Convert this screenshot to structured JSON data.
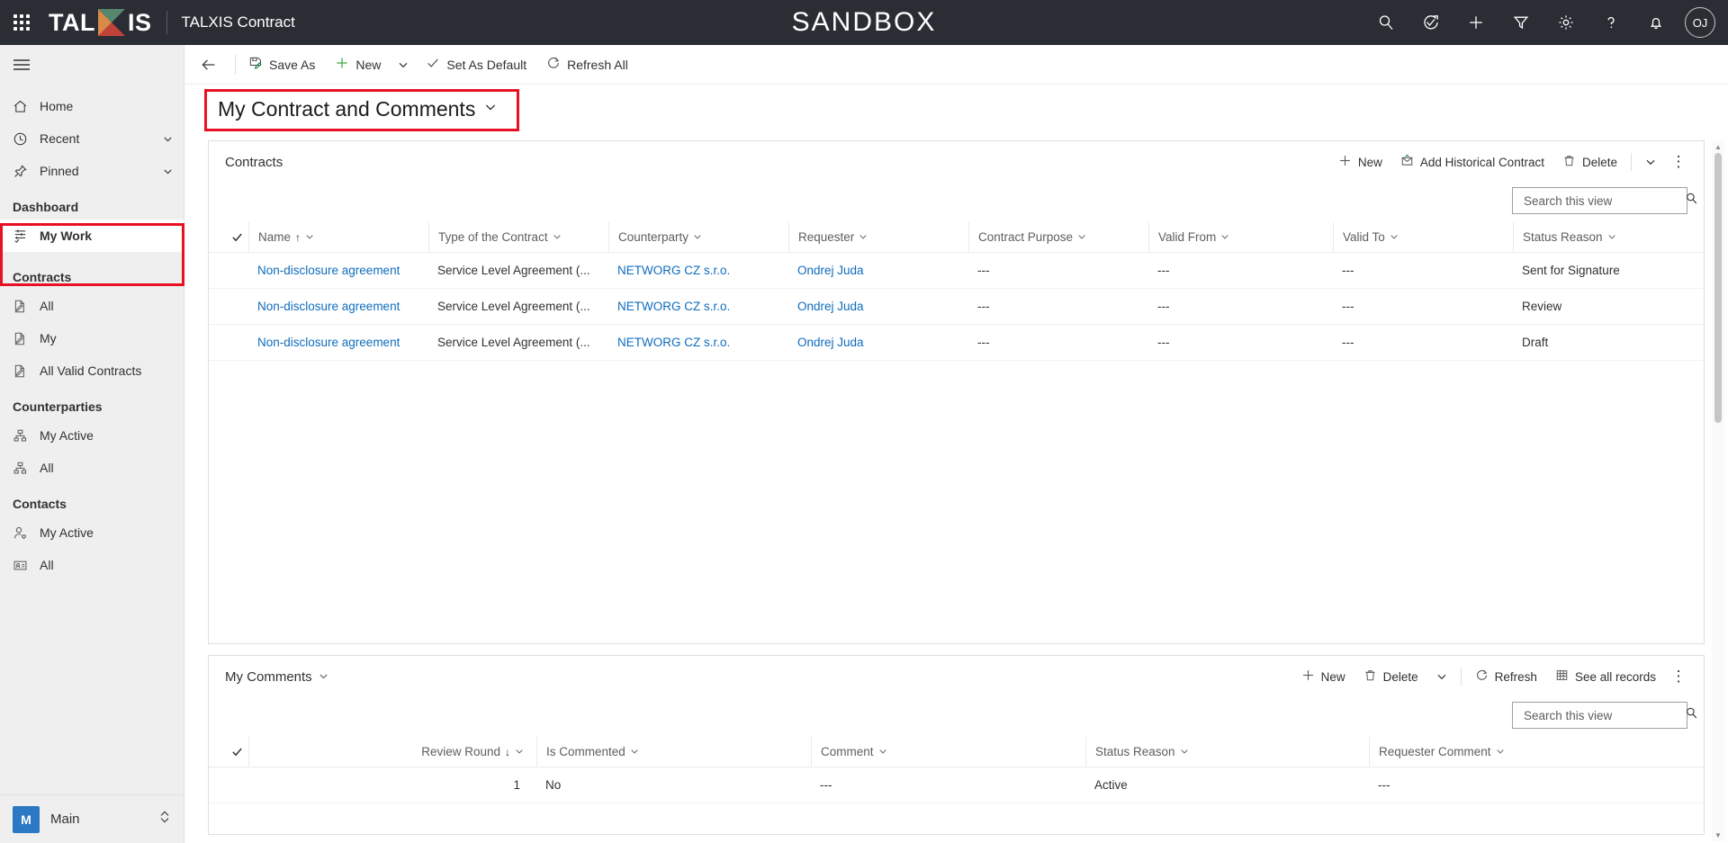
{
  "topbar": {
    "waffle_label": "app-launcher",
    "brand_pre": "TAL",
    "brand_post": "IS",
    "app_name": "TALXIS Contract",
    "environment": "SANDBOX",
    "actions": [
      {
        "name": "search-icon",
        "label": "Search"
      },
      {
        "name": "diagnostics-icon",
        "label": "Diagnostics"
      },
      {
        "name": "quick-create-icon",
        "label": "New"
      },
      {
        "name": "filter-icon",
        "label": "Filter"
      },
      {
        "name": "settings-gear-icon",
        "label": "Settings"
      },
      {
        "name": "help-icon",
        "label": "Help"
      },
      {
        "name": "notifications-bell-icon",
        "label": "Notifications"
      }
    ],
    "avatar_initials": "OJ"
  },
  "sidebar": {
    "hamburger_label": "Expand/collapse navigation",
    "primary": [
      {
        "label": "Home",
        "icon": "home-icon",
        "chevron": false
      },
      {
        "label": "Recent",
        "icon": "clock-icon",
        "chevron": true
      },
      {
        "label": "Pinned",
        "icon": "pin-icon",
        "chevron": true
      }
    ],
    "groups": [
      {
        "title": "Dashboard",
        "items": [
          {
            "label": "My Work",
            "icon": "dashboard-icon",
            "selected": true
          }
        ]
      },
      {
        "title": "Contracts",
        "items": [
          {
            "label": "All",
            "icon": "document-edit-icon",
            "selected": false
          },
          {
            "label": "My",
            "icon": "document-edit-icon",
            "selected": false
          },
          {
            "label": "All Valid Contracts",
            "icon": "document-edit-icon",
            "selected": false
          }
        ]
      },
      {
        "title": "Counterparties",
        "items": [
          {
            "label": "My Active",
            "icon": "org-chart-icon",
            "selected": false
          },
          {
            "label": "All",
            "icon": "org-chart-icon",
            "selected": false
          }
        ]
      },
      {
        "title": "Contacts",
        "items": [
          {
            "label": "My Active",
            "icon": "contact-person-icon",
            "selected": false
          },
          {
            "label": "All",
            "icon": "contact-card-icon",
            "selected": false
          }
        ]
      }
    ],
    "area": {
      "badge": "M",
      "label": "Main"
    }
  },
  "commandbar": {
    "back_label": "Back",
    "buttons": [
      {
        "label": "Save As",
        "icon": "save-as-icon",
        "caret": false
      },
      {
        "label": "New",
        "icon": "plus-icon",
        "caret": true
      },
      {
        "label": "Set As Default",
        "icon": "checkmark-icon",
        "caret": false
      },
      {
        "label": "Refresh All",
        "icon": "refresh-icon",
        "caret": false
      }
    ]
  },
  "page": {
    "title": "My Contract and Comments",
    "title_chevron": "chevron-down-icon"
  },
  "contracts": {
    "title": "Contracts",
    "tools": [
      {
        "label": "New",
        "icon": "plus-icon"
      },
      {
        "label": "Add Historical Contract",
        "icon": "add-historical-icon"
      },
      {
        "label": "Delete",
        "icon": "trash-icon"
      }
    ],
    "tool_caret": "chevron-down-icon",
    "tool_more": "overflow-icon",
    "search": {
      "placeholder": "Search this view",
      "value": "",
      "icon": "search-icon"
    },
    "columns": [
      {
        "label": "Name",
        "sort": "↑"
      },
      {
        "label": "Type of the Contract",
        "sort": ""
      },
      {
        "label": "Counterparty",
        "sort": ""
      },
      {
        "label": "Requester",
        "sort": ""
      },
      {
        "label": "Contract Purpose",
        "sort": ""
      },
      {
        "label": "Valid From",
        "sort": ""
      },
      {
        "label": "Valid To",
        "sort": ""
      },
      {
        "label": "Status Reason",
        "sort": ""
      }
    ],
    "rows": [
      {
        "name": "Non-disclosure agreement",
        "type": "Service Level Agreement (...",
        "counterparty": "NETWORG CZ s.r.o.",
        "requester": "Ondrej Juda",
        "purpose": "---",
        "valid_from": "---",
        "valid_to": "---",
        "status": "Sent for Signature"
      },
      {
        "name": "Non-disclosure agreement",
        "type": "Service Level Agreement (...",
        "counterparty": "NETWORG CZ s.r.o.",
        "requester": "Ondrej Juda",
        "purpose": "---",
        "valid_from": "---",
        "valid_to": "---",
        "status": "Review"
      },
      {
        "name": "Non-disclosure agreement",
        "type": "Service Level Agreement (...",
        "counterparty": "NETWORG CZ s.r.o.",
        "requester": "Ondrej Juda",
        "purpose": "---",
        "valid_from": "---",
        "valid_to": "---",
        "status": "Draft"
      }
    ]
  },
  "comments": {
    "title": "My Comments",
    "title_chevron": "chevron-down-icon",
    "tools": [
      {
        "label": "New",
        "icon": "plus-icon"
      },
      {
        "label": "Delete",
        "icon": "trash-icon"
      }
    ],
    "tool_caret": "chevron-down-icon",
    "tools2": [
      {
        "label": "Refresh",
        "icon": "refresh-icon"
      },
      {
        "label": "See all records",
        "icon": "grid-icon"
      }
    ],
    "tool_more": "overflow-icon",
    "search": {
      "placeholder": "Search this view",
      "value": "",
      "icon": "search-icon"
    },
    "columns": [
      {
        "label": "Review Round",
        "sort": "↓"
      },
      {
        "label": "Is Commented",
        "sort": ""
      },
      {
        "label": "Comment",
        "sort": ""
      },
      {
        "label": "Status Reason",
        "sort": ""
      },
      {
        "label": "Requester Comment",
        "sort": ""
      }
    ],
    "rows": [
      {
        "round": "1",
        "is_commented": "No",
        "comment": "---",
        "status": "Active",
        "requester_comment": "---"
      }
    ]
  },
  "colors": {
    "topbar_bg": "#2b2d35",
    "accent": "#0078d4",
    "link": "#0f6cbd",
    "highlight": "#e81123",
    "area_badge": "#2b78c4"
  }
}
